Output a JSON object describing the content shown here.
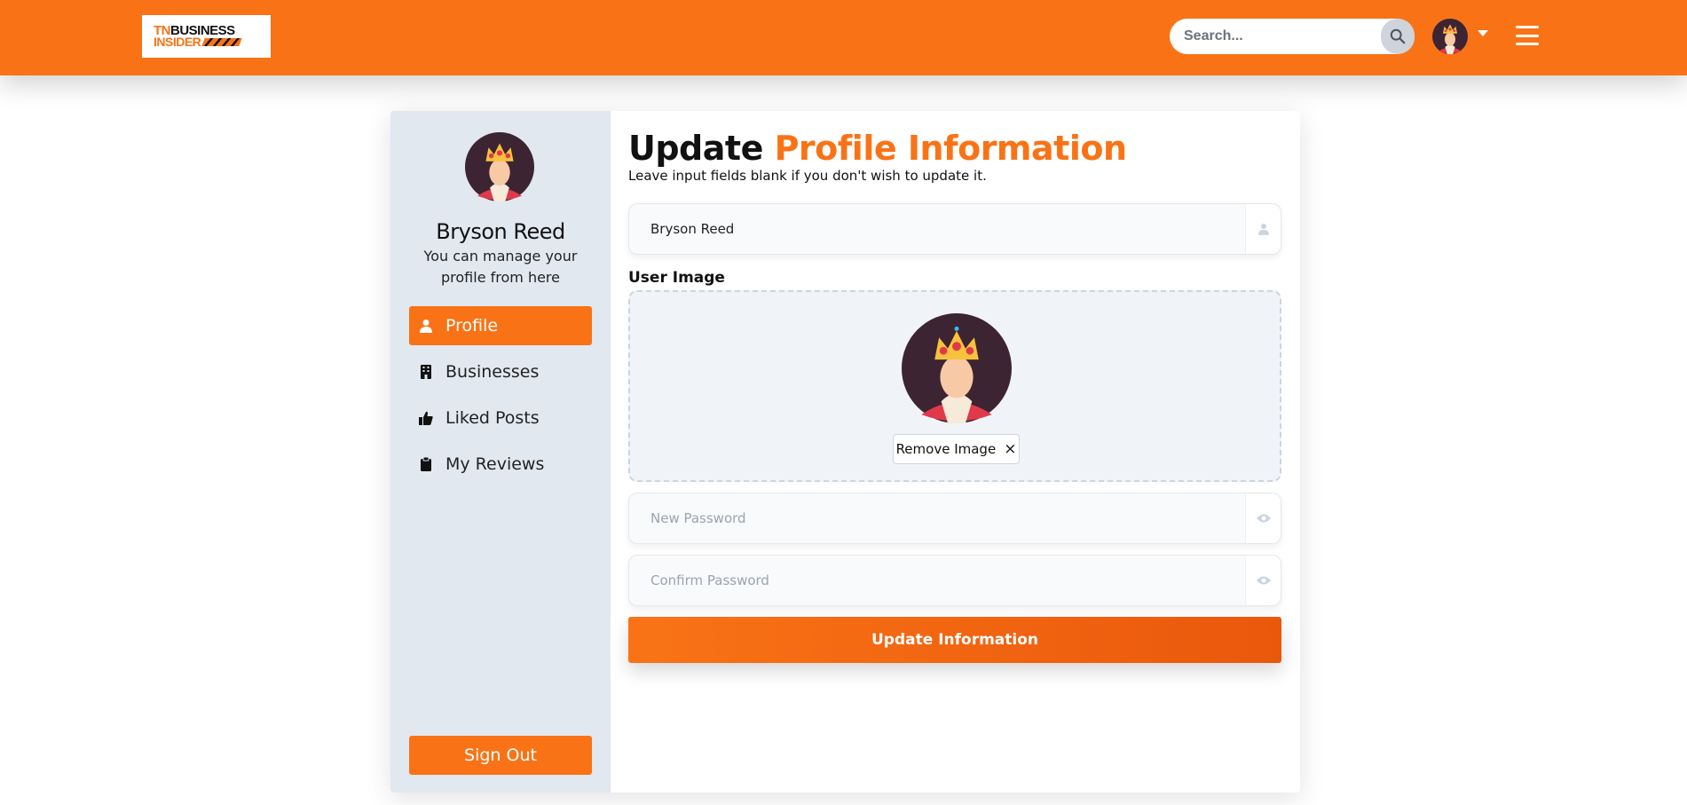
{
  "header": {
    "logo": {
      "line1_prefix": "TN",
      "line1_rest": "BUSINESS",
      "line2": "INSIDER"
    },
    "search": {
      "placeholder": "Search..."
    },
    "icons": {
      "search": "search-icon",
      "user_menu": "chevron-down-icon",
      "menu": "hamburger-icon"
    }
  },
  "sidebar": {
    "name": "Bryson Reed",
    "subtitle": "You can manage your profile from here",
    "items": [
      {
        "label": "Profile",
        "icon": "user-icon",
        "active": true
      },
      {
        "label": "Businesses",
        "icon": "building-icon",
        "active": false
      },
      {
        "label": "Liked Posts",
        "icon": "thumbs-up-icon",
        "active": false
      },
      {
        "label": "My Reviews",
        "icon": "clipboard-icon",
        "active": false
      }
    ],
    "signout_label": "Sign Out"
  },
  "form": {
    "title_part1": "Update ",
    "title_part2": "Profile Information",
    "subtitle": "Leave input fields blank if you don't wish to update it.",
    "name_value": "Bryson Reed",
    "image_label": "User Image",
    "remove_image_label": "Remove Image",
    "remove_icon": "×",
    "new_password_placeholder": "New Password",
    "confirm_password_placeholder": "Confirm Password",
    "submit_label": "Update Information"
  },
  "colors": {
    "accent": "#f97316",
    "sidebar_bg": "#e2e8f0",
    "dropzone_bg": "#f0f4f8"
  }
}
